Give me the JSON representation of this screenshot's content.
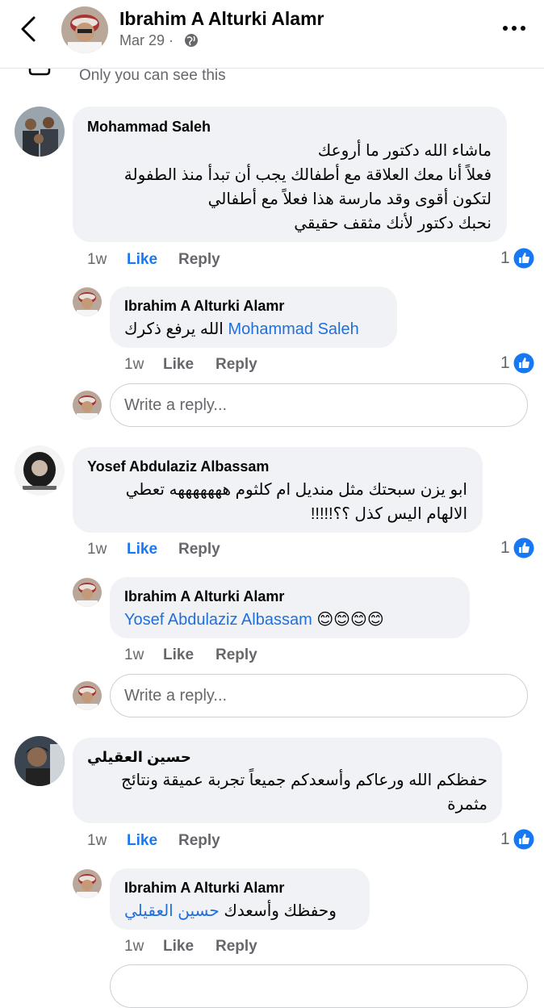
{
  "header": {
    "author": "Ibrahim A Alturki Alamr",
    "date": "Mar 29 ·",
    "visibility": "Only you can see this"
  },
  "comments": [
    {
      "name": "Mohammad Saleh",
      "lines": [
        "ماشاء الله دكتور ما أروعك",
        "فعلاً أنا معك العلاقة مع أطفالك يجب أن تبدأ منذ الطفولة",
        "لتكون أقوى وقد مارسة هذا فعلاً مع أطفالي",
        "نحبك دكتور لأنك مثقف حقيقي"
      ],
      "time": "1w",
      "like": "Like",
      "reply": "Reply",
      "reactions": "1",
      "reply_item": {
        "name": "Ibrahim A Alturki Alamr",
        "text": "الله يرفع ذكرك",
        "mention": "Mohammad Saleh",
        "time": "1w",
        "like": "Like",
        "reply": "Reply",
        "reactions": "1"
      },
      "write_placeholder": "Write a reply..."
    },
    {
      "name": "Yosef Abdulaziz Albassam",
      "lines": [
        "ابو يزن سبحتك مثل منديل ام كلثوم هههههههه تعطي",
        "الالهام اليس كذل ؟؟!!!!!"
      ],
      "time": "1w",
      "like": "Like",
      "reply": "Reply",
      "reactions": "1",
      "reply_item": {
        "name": "Ibrahim A Alturki Alamr",
        "mention": "Yosef Abdulaziz Albassam",
        "emojis": "😊😊😊😊",
        "time": "1w",
        "like": "Like",
        "reply": "Reply"
      },
      "write_placeholder": "Write a reply..."
    },
    {
      "name": "حسين العقيلي",
      "lines": [
        "حفظكم الله ورعاكم وأسعدكم جميعاً تجربة عميقة ونتائج",
        "مثمرة"
      ],
      "time": "1w",
      "like": "Like",
      "reply": "Reply",
      "reactions": "1",
      "reply_item": {
        "name": "Ibrahim A Alturki Alamr",
        "text": "وحفظك وأسعدك",
        "mention": "حسين العقيلي",
        "time": "1w",
        "like": "Like",
        "reply": "Reply"
      }
    }
  ],
  "colors": {
    "link": "#216fdb",
    "liked": "#1877f2",
    "bubble": "#f0f2f5",
    "meta": "#65676b"
  }
}
